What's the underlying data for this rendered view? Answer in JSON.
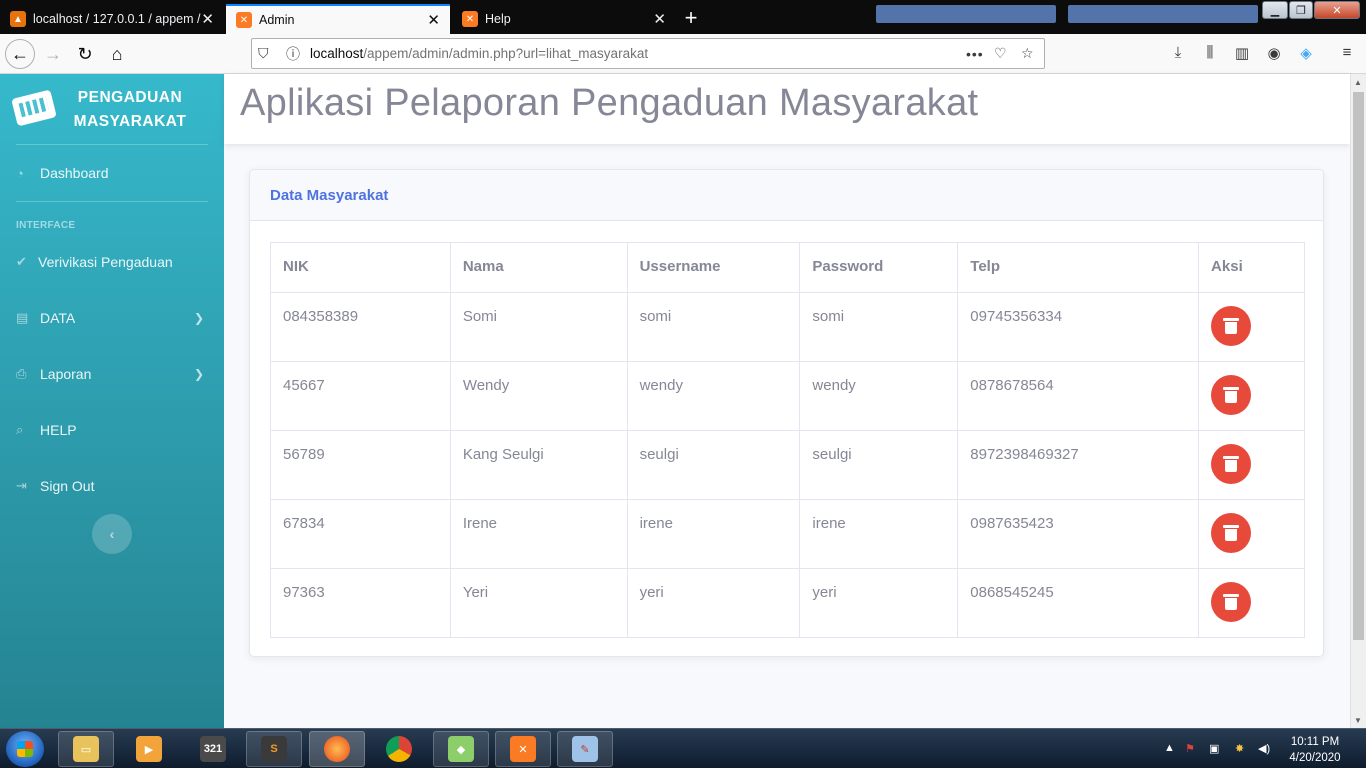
{
  "browser": {
    "tabs": [
      {
        "label": "localhost / 127.0.0.1 / appem / ...",
        "icon": "phpmyadmin-icon"
      },
      {
        "label": "Admin",
        "icon": "xampp-icon",
        "active": true
      },
      {
        "label": "Help",
        "icon": "xampp-icon"
      }
    ],
    "url_host": "localhost",
    "url_path": "/appem/admin/admin.php?url=lihat_masyarakat"
  },
  "sidebar": {
    "brand_line1": "PENGADUAN",
    "brand_line2": "MASYARAKAT",
    "dashboard": "Dashboard",
    "heading": "INTERFACE",
    "verifikasi": "Verivikasi Pengaduan",
    "data": "DATA",
    "laporan": "Laporan",
    "help": "HELP",
    "signout": "Sign Out",
    "toggle_glyph": "‹"
  },
  "header": {
    "title": "Aplikasi Pelaporan Pengaduan Masyarakat"
  },
  "card": {
    "title": "Data Masyarakat",
    "columns": [
      "NIK",
      "Nama",
      "Ussername",
      "Password",
      "Telp",
      "Aksi"
    ],
    "rows": [
      {
        "nik": "084358389",
        "nama": "Somi",
        "username": "somi",
        "password": "somi",
        "telp": "09745356334"
      },
      {
        "nik": "45667",
        "nama": "Wendy",
        "username": "wendy",
        "password": "wendy",
        "telp": "0878678564"
      },
      {
        "nik": "56789",
        "nama": "Kang Seulgi",
        "username": "seulgi",
        "password": "seulgi",
        "telp": "8972398469327"
      },
      {
        "nik": "67834",
        "nama": "Irene",
        "username": "irene",
        "password": "irene",
        "telp": "0987635423"
      },
      {
        "nik": "97363",
        "nama": "Yeri",
        "username": "yeri",
        "password": "yeri",
        "telp": "0868545245"
      }
    ]
  },
  "taskbar": {
    "time": "10:11 PM",
    "date": "4/20/2020"
  },
  "colors": {
    "sidebar_top": "#36b9cc",
    "sidebar_bottom": "#258391",
    "accent": "#4e73df",
    "danger": "#e74a3b",
    "text": "#858796"
  }
}
